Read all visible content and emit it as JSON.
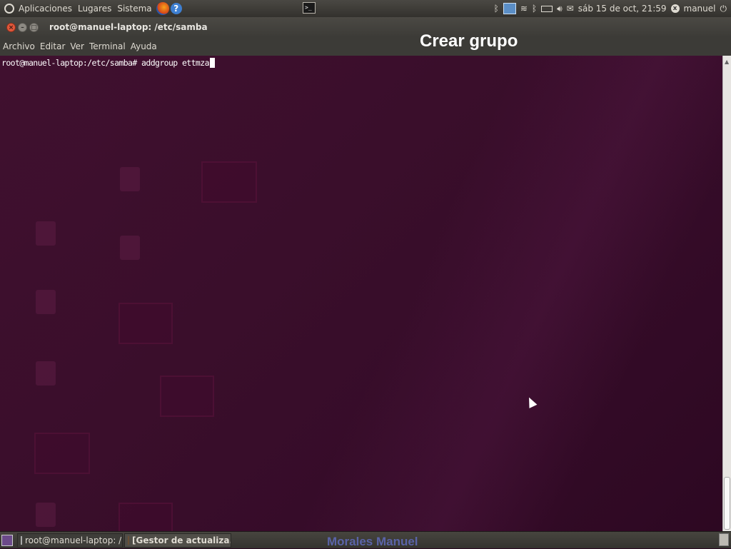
{
  "top_panel": {
    "menus": [
      "Aplicaciones",
      "Lugares",
      "Sistema"
    ],
    "clock": "sáb 15 de oct, 21:59",
    "user": "manuel"
  },
  "window": {
    "title": "root@manuel-laptop: /etc/samba",
    "menu": [
      "Archivo",
      "Editar",
      "Ver",
      "Terminal",
      "Ayuda"
    ]
  },
  "overlay": {
    "title": "Crear grupo"
  },
  "terminal": {
    "prompt": "root@manuel-laptop:/etc/samba#",
    "command": "addgroup ettmza"
  },
  "taskbar": {
    "tasks": [
      {
        "label": "root@manuel-laptop: /e...",
        "icon": "terminal-icon"
      },
      {
        "label": "[Gestor de actualiza...",
        "icon": "package-icon"
      }
    ],
    "credit": "Morales Manuel"
  },
  "colors": {
    "terminal_bg": "#3a0e2b",
    "panel_bg": "#3c3b37",
    "close_button": "#e0573a",
    "credit_text": "#5a63a8"
  }
}
